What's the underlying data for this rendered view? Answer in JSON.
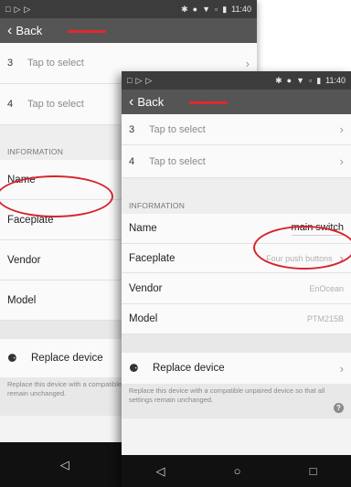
{
  "status_bar": {
    "time": "11:40"
  },
  "app_bar": {
    "back_label": "Back"
  },
  "back_screen": {
    "slots": [
      {
        "num": "3",
        "placeholder": "Tap to select"
      },
      {
        "num": "4",
        "placeholder": "Tap to select"
      }
    ],
    "section_title": "INFORMATION",
    "fields": {
      "name": "Name",
      "faceplate": "Faceplate",
      "vendor": "Vendor",
      "model": "Model"
    },
    "replace_label": "Replace device",
    "replace_desc": "Replace this device with a compatible unpaired device so that all settings remain unchanged."
  },
  "front_screen": {
    "slots": [
      {
        "num": "3",
        "placeholder": "Tap to select"
      },
      {
        "num": "4",
        "placeholder": "Tap to select"
      }
    ],
    "section_title": "INFORMATION",
    "name": {
      "label": "Name",
      "value": "main switch"
    },
    "faceplate": {
      "label": "Faceplate",
      "value": "Four push buttons"
    },
    "vendor": {
      "label": "Vendor",
      "value": "EnOcean"
    },
    "model": {
      "label": "Model",
      "value": "PTM215B"
    },
    "replace_label": "Replace device",
    "replace_desc": "Replace this device with a compatible unpaired device so that all settings remain unchanged."
  },
  "icons": {
    "back": "chevron-left-icon",
    "bluetooth": "bluetooth-icon",
    "wifi": "wifi-icon",
    "battery": "battery-icon",
    "help": "help-icon",
    "nav_back": "nav-back-icon",
    "nav_home": "nav-home-icon",
    "nav_recents": "nav-recents-icon"
  },
  "colors": {
    "annotation": "#d7232b",
    "app_bar": "#555555",
    "status_bar": "#3c3c3c",
    "nav_bar": "#111111"
  }
}
